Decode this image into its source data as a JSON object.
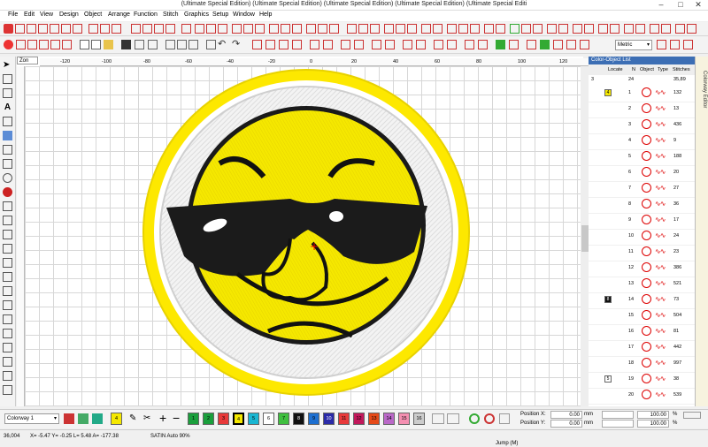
{
  "window": {
    "title": "(Ultimate Special Edition) (Ultimate Special Edition) (Ultimate Special Edition) (Ultimate Special Edition) (Ultimate Special Editi"
  },
  "menu": [
    "File",
    "Edit",
    "View",
    "Design",
    "Object",
    "Arrange",
    "Function",
    "Stitch",
    "Graphics",
    "Setup",
    "Window",
    "Help"
  ],
  "toolbar": {
    "units": "Metric"
  },
  "canvas": {
    "tab": "Zon",
    "ruler_marks": [
      "-120",
      "-100",
      "-80",
      "-60",
      "-40",
      "-20",
      "0",
      "20",
      "40",
      "60",
      "80",
      "100",
      "120"
    ]
  },
  "panel": {
    "title": "Color-Object List",
    "col_locate": "Locate",
    "col_n": "N",
    "col_obj": "Object",
    "col_type": "Type",
    "col_stitches": "Stitches",
    "sum_groups": "3",
    "sum_objects": "24",
    "sum_stitches": "35,89",
    "rows": [
      {
        "n": "1",
        "st": "132",
        "g": "4"
      },
      {
        "n": "2",
        "st": "13"
      },
      {
        "n": "3",
        "st": "436"
      },
      {
        "n": "4",
        "st": "9"
      },
      {
        "n": "5",
        "st": "188"
      },
      {
        "n": "6",
        "st": "20"
      },
      {
        "n": "7",
        "st": "27"
      },
      {
        "n": "8",
        "st": "36"
      },
      {
        "n": "9",
        "st": "17"
      },
      {
        "n": "10",
        "st": "24"
      },
      {
        "n": "11",
        "st": "23"
      },
      {
        "n": "12",
        "st": "386"
      },
      {
        "n": "13",
        "st": "521"
      },
      {
        "n": "14",
        "st": "73",
        "g": "8"
      },
      {
        "n": "15",
        "st": "504"
      },
      {
        "n": "16",
        "st": "81"
      },
      {
        "n": "17",
        "st": "442"
      },
      {
        "n": "18",
        "st": "997"
      },
      {
        "n": "19",
        "st": "38",
        "g": "5"
      },
      {
        "n": "20",
        "st": "539"
      }
    ]
  },
  "coloredge": {
    "label": "Colorway Editor"
  },
  "bottombar": {
    "colorway": "Colorway 1",
    "swatches": [
      "4",
      "1",
      "2",
      "3",
      "4",
      "5",
      "6",
      "7",
      "8",
      "9",
      "10",
      "11",
      "12",
      "13",
      "14",
      "15",
      "16"
    ],
    "pos_x": "Position X:",
    "pos_y": "Position Y:",
    "pos_x_val": "0.00",
    "pos_y_val": "0.00",
    "pct1": "100.00",
    "pct2": "100.00",
    "unit_mm": "mm",
    "unit_pct": "%"
  },
  "status": {
    "stitches": "36,004",
    "coords": "X= -5.47 Y= -0.25 L= 5.48 A= -177.38",
    "mode": "SATIN Auto 90%",
    "jump": "Jump (M)"
  },
  "colors": {
    "yellow": "#f5e800",
    "red": "#e8393a",
    "blue": "#3c6eb4"
  }
}
